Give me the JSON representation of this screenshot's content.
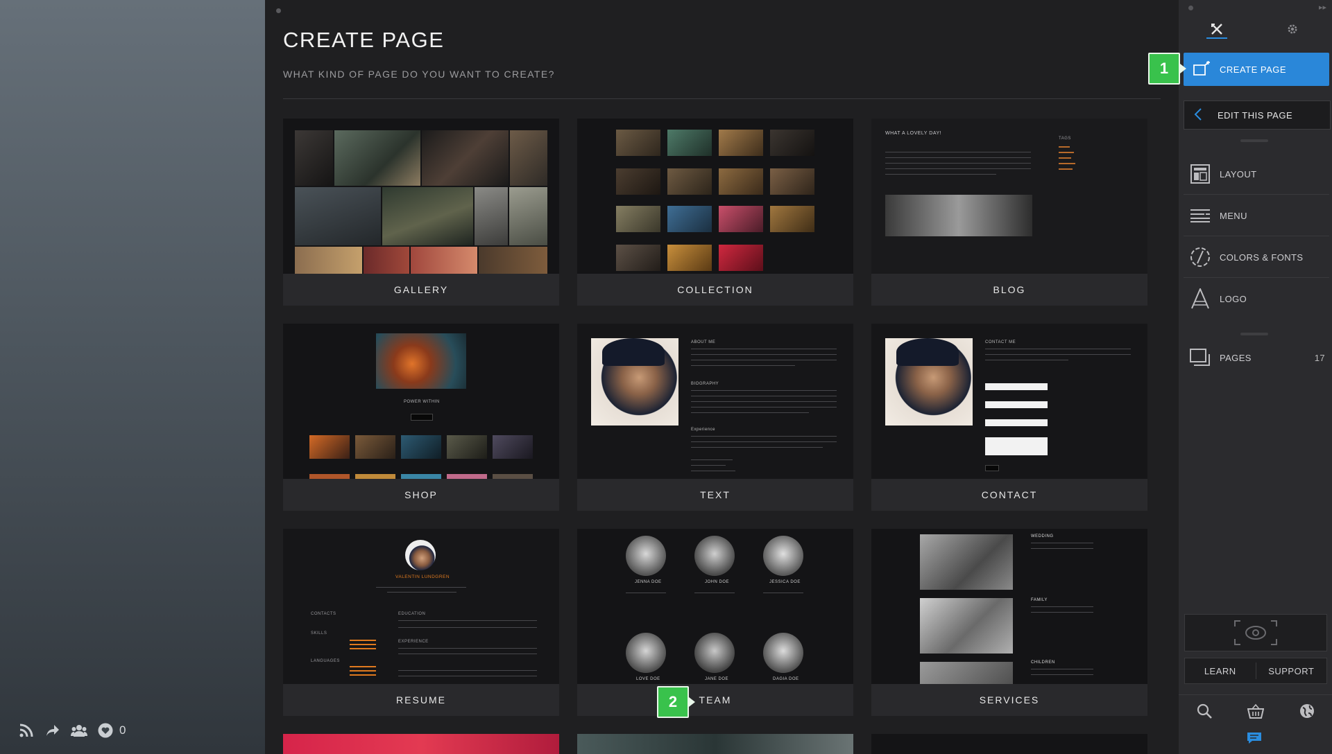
{
  "main": {
    "title": "CREATE PAGE",
    "subtitle": "WHAT KIND OF PAGE DO YOU WANT TO CREATE?",
    "cards": [
      {
        "label": "GALLERY"
      },
      {
        "label": "COLLECTION"
      },
      {
        "label": "BLOG"
      },
      {
        "label": "SHOP"
      },
      {
        "label": "TEXT"
      },
      {
        "label": "CONTACT"
      },
      {
        "label": "RESUME"
      },
      {
        "label": "TEAM"
      },
      {
        "label": "SERVICES"
      }
    ],
    "previews": {
      "blog_title": "WHAT A LOVELY DAY!",
      "blog_tags": "TAGS",
      "shop_product": "POWER WITHIN",
      "text_about": "ABOUT ME",
      "text_bio": "BIOGRAPHY",
      "text_exp": "Experience",
      "contact_title": "CONTACT ME",
      "resume_name": "VALENTIN LUNDGREN",
      "resume_contacts": "CONTACTS",
      "resume_skills": "SKILLS",
      "resume_languages": "LANGUAGES",
      "resume_education": "EDUCATION",
      "resume_experience": "EXPERIENCE",
      "team_members": [
        "JENNA DOE",
        "JOHN DOE",
        "JESSICA DOE",
        "LOVE DOE",
        "JANE DOE",
        "DAGIA DOE"
      ],
      "services_items": [
        "WEDDING",
        "FAMILY",
        "CHILDREN"
      ]
    }
  },
  "sidebar": {
    "create_page": "CREATE PAGE",
    "edit_page": "EDIT THIS PAGE",
    "menu": [
      {
        "label": "LAYOUT"
      },
      {
        "label": "MENU"
      },
      {
        "label": "COLORS & FONTS"
      },
      {
        "label": "LOGO"
      }
    ],
    "pages_label": "PAGES",
    "pages_count": "17",
    "learn": "LEARN",
    "support": "SUPPORT"
  },
  "left": {
    "likes_count": "0"
  },
  "callouts": {
    "one": "1",
    "two": "2"
  },
  "colors": {
    "accent": "#2a87d9",
    "callout": "#39c24c",
    "orange": "#e07a1f"
  }
}
